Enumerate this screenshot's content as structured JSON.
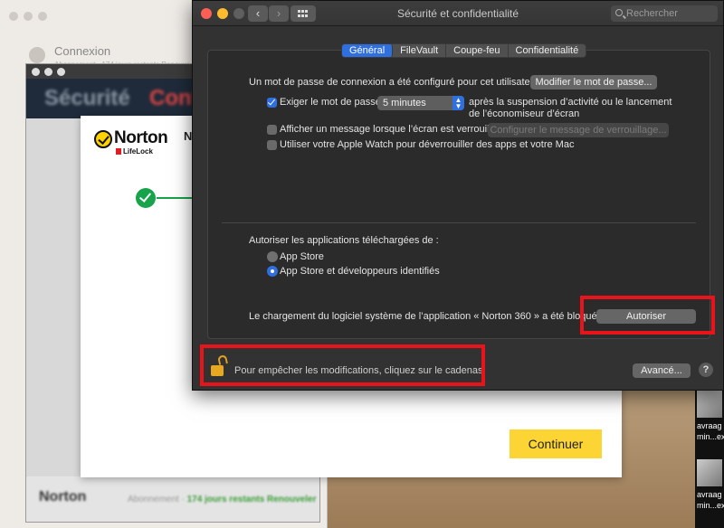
{
  "background_window": {
    "title": "Connexion",
    "subtitle": "Abonnement · 174 jours restants  Renouve..."
  },
  "norton_window": {
    "header_left": "Sécurité",
    "header_right": "Config",
    "footer_logo": "Norton",
    "footer_info_prefix": "Abonnement",
    "footer_info_days": "174 jours restants",
    "footer_info_action": "Renouveler"
  },
  "norton_dialog": {
    "logo_name": "Norton",
    "logo_sub": "LifeLock",
    "heading_start": "N",
    "continue_label": "Continuer"
  },
  "security_window": {
    "title": "Sécurité et confidentialité",
    "search_placeholder": "Rechercher",
    "tabs": [
      {
        "label": "Général",
        "active": true
      },
      {
        "label": "FileVault",
        "active": false
      },
      {
        "label": "Coupe-feu",
        "active": false
      },
      {
        "label": "Confidentialité",
        "active": false
      }
    ],
    "general": {
      "password_set_text": "Un mot de passe de connexion a été configuré pour cet utilisateur",
      "change_password_button": "Modifier le mot de passe...",
      "require_password_label": "Exiger le mot de passe",
      "require_password_checked": true,
      "require_password_delay": "5 minutes",
      "require_password_after_line1": "après la suspension d’activité ou le lancement",
      "require_password_after_line2": "de l’économiseur d’écran",
      "show_message_label": "Afficher un message lorsque l’écran est verrouillé",
      "show_message_checked": false,
      "set_lock_message_button": "Configurer le message de verrouillage...",
      "apple_watch_label": "Utiliser votre Apple Watch pour déverrouiller des apps et votre Mac",
      "apple_watch_checked": false,
      "allow_apps_heading": "Autoriser les applications téléchargées de :",
      "radio_options": [
        {
          "label": "App Store",
          "selected": false
        },
        {
          "label": "App Store et développeurs identifiés",
          "selected": true
        }
      ],
      "blocked_message": "Le chargement du logiciel système de l’application « Norton 360 » a été bloqué.",
      "allow_button": "Autoriser"
    },
    "lock_text": "Pour empêcher les modifications, cliquez sur le cadenas.",
    "advanced_button": "Avancé...",
    "help_label": "?"
  },
  "dock_strip": {
    "items": [
      "avraag",
      "min...ex",
      "avraag",
      "min...ex"
    ]
  },
  "colors": {
    "annotation_red": "#e8131b",
    "accent_blue": "#2f6fe0",
    "norton_yellow": "#fcd535",
    "success_green": "#16a34a"
  }
}
